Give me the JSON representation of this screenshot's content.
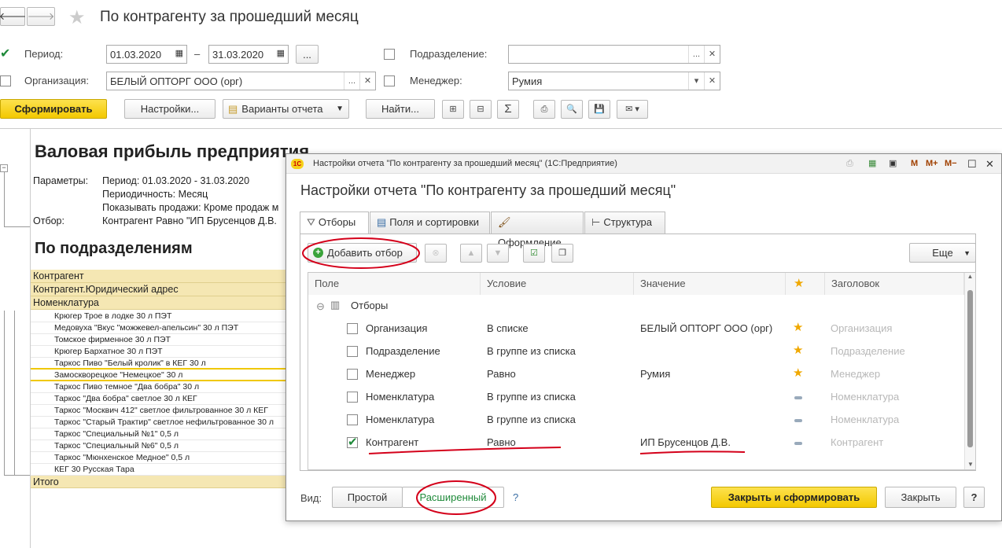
{
  "window_title": "По контрагенту за прошедший месяц",
  "filters": {
    "period_label": "Период:",
    "period_from": "01.03.2020",
    "period_dash": "–",
    "period_to": "31.03.2020",
    "period_more": "...",
    "org_label": "Организация:",
    "org_value": "БЕЛЫЙ ОПТОРГ ООО (орг)",
    "subdivision_label": "Подразделение:",
    "subdivision_value": "",
    "manager_label": "Менеджер:",
    "manager_value": "Румия"
  },
  "toolbar": {
    "generate": "Сформировать",
    "settings": "Настройки...",
    "variants": "Варианты отчета",
    "find": "Найти...",
    "sum": "Σ"
  },
  "report": {
    "title": "Валовая прибыль предприятия",
    "params_label": "Параметры:",
    "param1": "Период: 01.03.2020 - 31.03.2020",
    "param2": "Периодичность: Месяц",
    "param3": "Показывать продажи: Кроме продаж м",
    "filter_label": "Отбор:",
    "filter_value": "Контрагент Равно \"ИП Брусенцов Д.В.",
    "section": "По подразделениям",
    "group_rows": [
      "Контрагент",
      "Контрагент.Юридический адрес",
      "Номенклатура"
    ],
    "items": [
      "Крюгер Трое в лодке 30 л ПЭТ",
      "Медовуха \"Вкус \"можжевел-апельсин\" 30 л ПЭТ",
      "Томское фирменное 30 л ПЭТ",
      "Крюгер Бархатное 30 л ПЭТ",
      "Таркос Пиво \"Белый кролик\" в КЕГ 30 л",
      "Замоскворецкое \"Немецкое\" 30 л",
      "Таркос Пиво темное \"Два бобра\" 30 л",
      "Таркос \"Два бобра\" светлое 30 л КЕГ",
      "Таркос \"Москвич 412\" светлое фильтрованное 30 л КЕГ",
      "Таркос \"Старый Трактир\" светлое нефильтрованное 30 л",
      "Таркос \"Специальный №1\" 0,5 л",
      "Таркос \"Специальный №6\" 0,5 л",
      "Таркос  \"Мюнхенское Медное\" 0,5 л",
      "КЕГ 30 Русская Тара"
    ],
    "total": "Итого"
  },
  "dialog": {
    "titlebar": "Настройки отчета \"По контрагенту за прошедший месяц\"  (1С:Предприятие)",
    "heading": "Настройки отчета \"По контрагенту за прошедший месяц\"",
    "tbar_m": "M",
    "tbar_mplus": "M+",
    "tbar_mminus": "M−",
    "tabs": [
      "Отборы",
      "Поля и сортировки",
      "Оформление",
      "Структура"
    ],
    "add_filter": "Добавить отбор",
    "more": "Еще",
    "columns": [
      "Поле",
      "Условие",
      "Значение",
      "★",
      "Заголовок"
    ],
    "group": "Отборы",
    "rows": [
      {
        "field": "Организация",
        "cond": "В списке",
        "value": "БЕЛЫЙ ОПТОРГ ООО (орг)",
        "title": "Организация",
        "checked": false
      },
      {
        "field": "Подразделение",
        "cond": "В группе из списка",
        "value": "",
        "title": "Подразделение",
        "checked": false
      },
      {
        "field": "Менеджер",
        "cond": "Равно",
        "value": "Румия",
        "title": "Менеджер",
        "checked": false
      },
      {
        "field": "Номенклатура",
        "cond": "В группе из списка",
        "value": "",
        "title": "Номенклатура",
        "checked": false
      },
      {
        "field": "Номенклатура",
        "cond": "В группе из списка",
        "value": "",
        "title": "Номенклатура",
        "checked": false
      },
      {
        "field": "Контрагент",
        "cond": "Равно",
        "value": "ИП Брусенцов Д.В.",
        "title": "Контрагент",
        "checked": true
      }
    ],
    "view_label": "Вид:",
    "view_simple": "Простой",
    "view_extended": "Расширенный",
    "help": "?",
    "close_generate": "Закрыть и сформировать",
    "close": "Закрыть"
  },
  "colors": {
    "accent": "#f6d11a",
    "annotation": "#d4001a",
    "active_tab_green": "#1f8a3a"
  }
}
